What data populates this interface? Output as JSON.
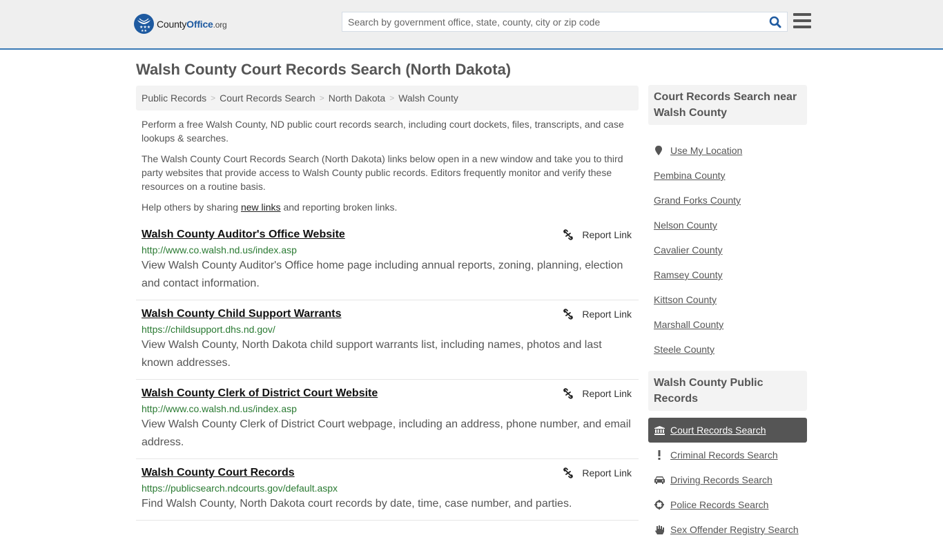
{
  "header": {
    "logo": {
      "county": "County",
      "office": "Office",
      "org": ".org"
    },
    "search": {
      "placeholder": "Search by government office, state, county, city or zip code",
      "value": ""
    },
    "colors": {
      "brand": "#1e5aa0",
      "accent_border": "#3a7ab5",
      "url_green": "#2a7a32"
    }
  },
  "page": {
    "title": "Walsh County Court Records Search (North Dakota)",
    "breadcrumb": [
      {
        "label": "Public Records"
      },
      {
        "label": "Court Records Search"
      },
      {
        "label": "North Dakota"
      },
      {
        "label": "Walsh County"
      }
    ],
    "breadcrumb_sep": ">",
    "intro": {
      "p1": "Perform a free Walsh County, ND public court records search, including court dockets, files, transcripts, and case lookups & searches.",
      "p2": "The Walsh County Court Records Search (North Dakota) links below open in a new window and take you to third party websites that provide access to Walsh County public records. Editors frequently monitor and verify these resources on a routine basis.",
      "p3_before": "Help others by sharing ",
      "p3_link": "new links",
      "p3_after": " and reporting broken links."
    }
  },
  "results": [
    {
      "title": "Walsh County Auditor's Office Website",
      "url": "http://www.co.walsh.nd.us/index.asp",
      "description": "View Walsh County Auditor's Office home page including annual reports, zoning, planning, election and contact information.",
      "report_label": "Report Link"
    },
    {
      "title": "Walsh County Child Support Warrants",
      "url": "https://childsupport.dhs.nd.gov/",
      "description": "View Walsh County, North Dakota child support warrants list, including names, photos and last known addresses.",
      "report_label": "Report Link"
    },
    {
      "title": "Walsh County Clerk of District Court Website",
      "url": "http://www.co.walsh.nd.us/index.asp",
      "description": "View Walsh County Clerk of District Court webpage, including an address, phone number, and email address.",
      "report_label": "Report Link"
    },
    {
      "title": "Walsh County Court Records",
      "url": "https://publicsearch.ndcourts.gov/default.aspx",
      "description": "Find Walsh County, North Dakota court records by date, time, case number, and parties.",
      "report_label": "Report Link"
    }
  ],
  "sidebar": {
    "near": {
      "heading": "Court Records Search near Walsh County",
      "use_location": "Use My Location",
      "counties": [
        "Pembina County",
        "Grand Forks County",
        "Nelson County",
        "Cavalier County",
        "Ramsey County",
        "Kittson County",
        "Marshall County",
        "Steele County"
      ]
    },
    "public_records": {
      "heading": "Walsh County Public Records",
      "items": [
        {
          "label": "Court Records Search",
          "icon": "courthouse-icon",
          "active": true
        },
        {
          "label": "Criminal Records Search",
          "icon": "exclamation-icon",
          "active": false
        },
        {
          "label": "Driving Records Search",
          "icon": "car-icon",
          "active": false
        },
        {
          "label": "Police Records Search",
          "icon": "crosshair-icon",
          "active": false
        },
        {
          "label": "Sex Offender Registry Search",
          "icon": "hand-icon",
          "active": false
        }
      ]
    }
  }
}
